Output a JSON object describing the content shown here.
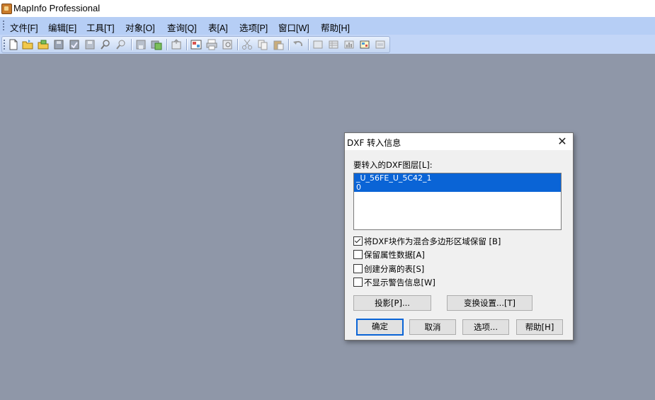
{
  "window": {
    "title": "MapInfo Professional",
    "icon": "mapinfo-app-icon"
  },
  "menubar": {
    "items": [
      "文件[F]",
      "编辑[E]",
      "工具[T]",
      "对象[O]",
      "查询[Q]",
      "表[A]",
      "选项[P]",
      "窗口[W]",
      "帮助[H]"
    ]
  },
  "toolbar": {
    "buttons": [
      "new-icon",
      "open-icon",
      "open-workspace-icon",
      "close-icon",
      "close-all-icon",
      "save-icon",
      "find-icon",
      "zoom-icon",
      "save-copy-icon",
      "save-workspace-icon",
      "export-icon",
      "print-setup-icon",
      "print-icon",
      "print-preview-icon",
      "cut-icon",
      "copy-icon",
      "paste-icon",
      "undo-icon",
      "map-window-icon",
      "browser-window-icon",
      "graph-window-icon",
      "layout-window-icon",
      "redistrict-window-icon"
    ]
  },
  "dialog": {
    "title": "DXF 转入信息",
    "close_glyph": "✕",
    "layers_label": "要转入的DXF图层[L]:",
    "layers": [
      "_U_56FE_U_5C42_1",
      "0"
    ],
    "checkboxes": [
      {
        "label": "将DXF块作为混合多边形区域保留 [B]",
        "checked": true
      },
      {
        "label": "保留属性数据[A]",
        "checked": false
      },
      {
        "label": "创建分离的表[S]",
        "checked": false
      },
      {
        "label": "不显示警告信息[W]",
        "checked": false
      }
    ],
    "projection_button": "投影[P]...",
    "transform_button": "变换设置...[T]",
    "ok_button": "确定",
    "cancel_button": "取消",
    "options_button": "选项...",
    "help_button": "帮助[H]"
  }
}
